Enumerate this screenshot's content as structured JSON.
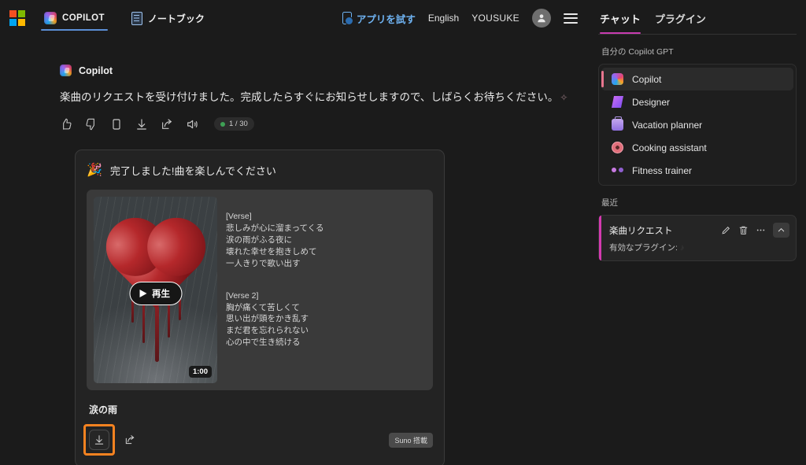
{
  "topbar": {
    "logo_icon": "microsoft-logo-icon",
    "tabs": [
      {
        "label": "COPILOT",
        "icon": "copilot-icon",
        "active": true
      },
      {
        "label": "ノートブック",
        "icon": "notebook-icon",
        "active": false
      }
    ],
    "try_app": {
      "label": "アプリを試す",
      "icon": "mobile-app-icon"
    },
    "language": "English",
    "user_name": "YOUSUKE",
    "avatar_icon": "person-avatar-icon",
    "menu_icon": "hamburger-menu-icon"
  },
  "message": {
    "author": "Copilot",
    "author_icon": "copilot-icon",
    "text": "楽曲のリクエストを受け付けました。完成したらすぐにお知らせしますので、しばらくお待ちください。",
    "sparkle": "✧",
    "actions": [
      {
        "name": "thumbs-up-icon"
      },
      {
        "name": "thumbs-down-icon"
      },
      {
        "name": "copy-icon"
      },
      {
        "name": "download-icon"
      },
      {
        "name": "export-icon"
      },
      {
        "name": "speaker-icon"
      }
    ],
    "counter": "1 / 30"
  },
  "song_card": {
    "banner_emoji": "🎉",
    "banner_text": "完了しました!曲を楽しんでください",
    "play_label": "再生",
    "play_icon": "play-triangle-icon",
    "duration": "1:00",
    "artwork_alt": "rain-heart-artwork",
    "lyrics": [
      "[Verse]\n悲しみが心に溜まってくる\n涙の雨がふる夜に\n壊れた幸せを抱きしめて\n一人きりで歌い出す",
      "[Verse 2]\n胸が痛くて苦しくて\n思い出が頭をかき乱す\nまだ君を忘れられない\n心の中で生き続ける"
    ],
    "title": "涙の雨",
    "download_icon": "download-icon",
    "share_icon": "share-icon",
    "badge": "Suno 搭載",
    "highlight_color": "#f58220"
  },
  "right_panel": {
    "tabs": [
      {
        "label": "チャット",
        "active": true
      },
      {
        "label": "プラグイン",
        "active": false
      }
    ],
    "gpt_section_label": "自分の Copilot GPT",
    "gpt_items": [
      {
        "label": "Copilot",
        "icon": "copilot-gpt-icon",
        "active": true
      },
      {
        "label": "Designer",
        "icon": "designer-icon",
        "active": false
      },
      {
        "label": "Vacation planner",
        "icon": "vacation-planner-icon",
        "active": false
      },
      {
        "label": "Cooking assistant",
        "icon": "cooking-assistant-icon",
        "active": false
      },
      {
        "label": "Fitness trainer",
        "icon": "fitness-trainer-icon",
        "active": false
      }
    ],
    "recent_label": "最近",
    "recent": {
      "title": "楽曲リクエスト",
      "subtitle": "有効なプラグイン:",
      "subtitle_icon": "music-note-icon",
      "edit_icon": "pencil-icon",
      "delete_icon": "trash-icon",
      "more_icon": "ellipsis-icon",
      "collapse_icon": "chevron-up-icon"
    }
  },
  "colors": {
    "background": "#1b1b1b",
    "accent_pink": "#c83cb0",
    "accent_blue": "#5b8fd6",
    "highlight_orange": "#f58220"
  }
}
